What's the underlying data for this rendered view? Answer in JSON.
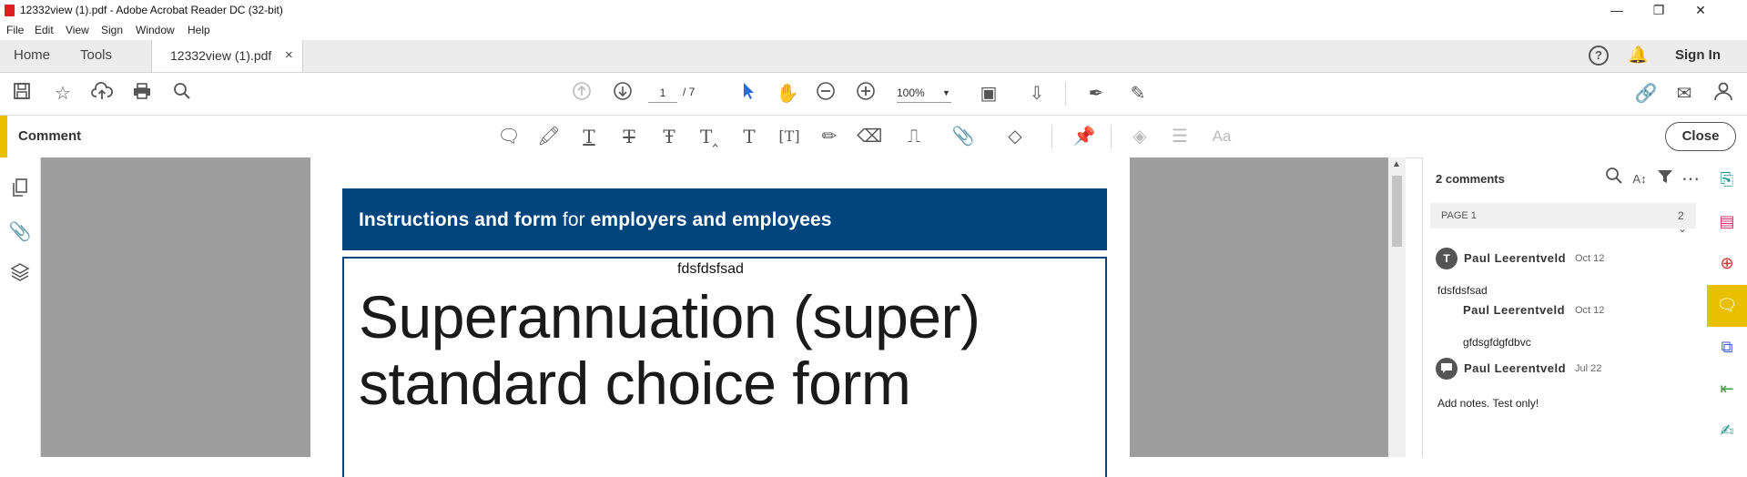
{
  "window": {
    "title": "12332view (1).pdf - Adobe Acrobat Reader DC (32-bit)",
    "icons": {
      "minimize": "minimize-icon",
      "maximize": "restore-icon",
      "close": "close-icon"
    }
  },
  "menu": {
    "items": [
      "File",
      "Edit",
      "View",
      "Sign",
      "Window",
      "Help"
    ]
  },
  "tabs": {
    "home": "Home",
    "tools": "Tools",
    "document": "12332view (1).pdf",
    "close_glyph": "×",
    "sign_in": "Sign In"
  },
  "toolbar": {
    "current_page": "1",
    "total_pages": "/ 7",
    "zoom": "100%"
  },
  "comment_bar": {
    "label": "Comment",
    "close": "Close",
    "accent": "#e8c000"
  },
  "document": {
    "banner_bold_1": "Instructions and form",
    "banner_normal": " for ",
    "banner_bold_2": "employers and employees",
    "annotation_text": "fdsfdsfsad",
    "heading_line1": "Superannuation (super)",
    "heading_line2": "standard choice form",
    "banner_color": "#00457c"
  },
  "comments_panel": {
    "count": "2 comments",
    "page_label": "PAGE 1",
    "page_count": "2",
    "entries": [
      {
        "avatar": "T",
        "author": "Paul  Leerentveld",
        "date": "Oct 12",
        "text": "fdsfdsfsad"
      },
      {
        "avatar": "",
        "author": "Paul  Leerentveld",
        "date": "Oct 12",
        "text": "gfdsgfdgfdbvc"
      },
      {
        "avatar": "💬",
        "author": "Paul  Leerentveld",
        "date": "Jul 22",
        "text": "Add notes. Test only!"
      }
    ]
  }
}
